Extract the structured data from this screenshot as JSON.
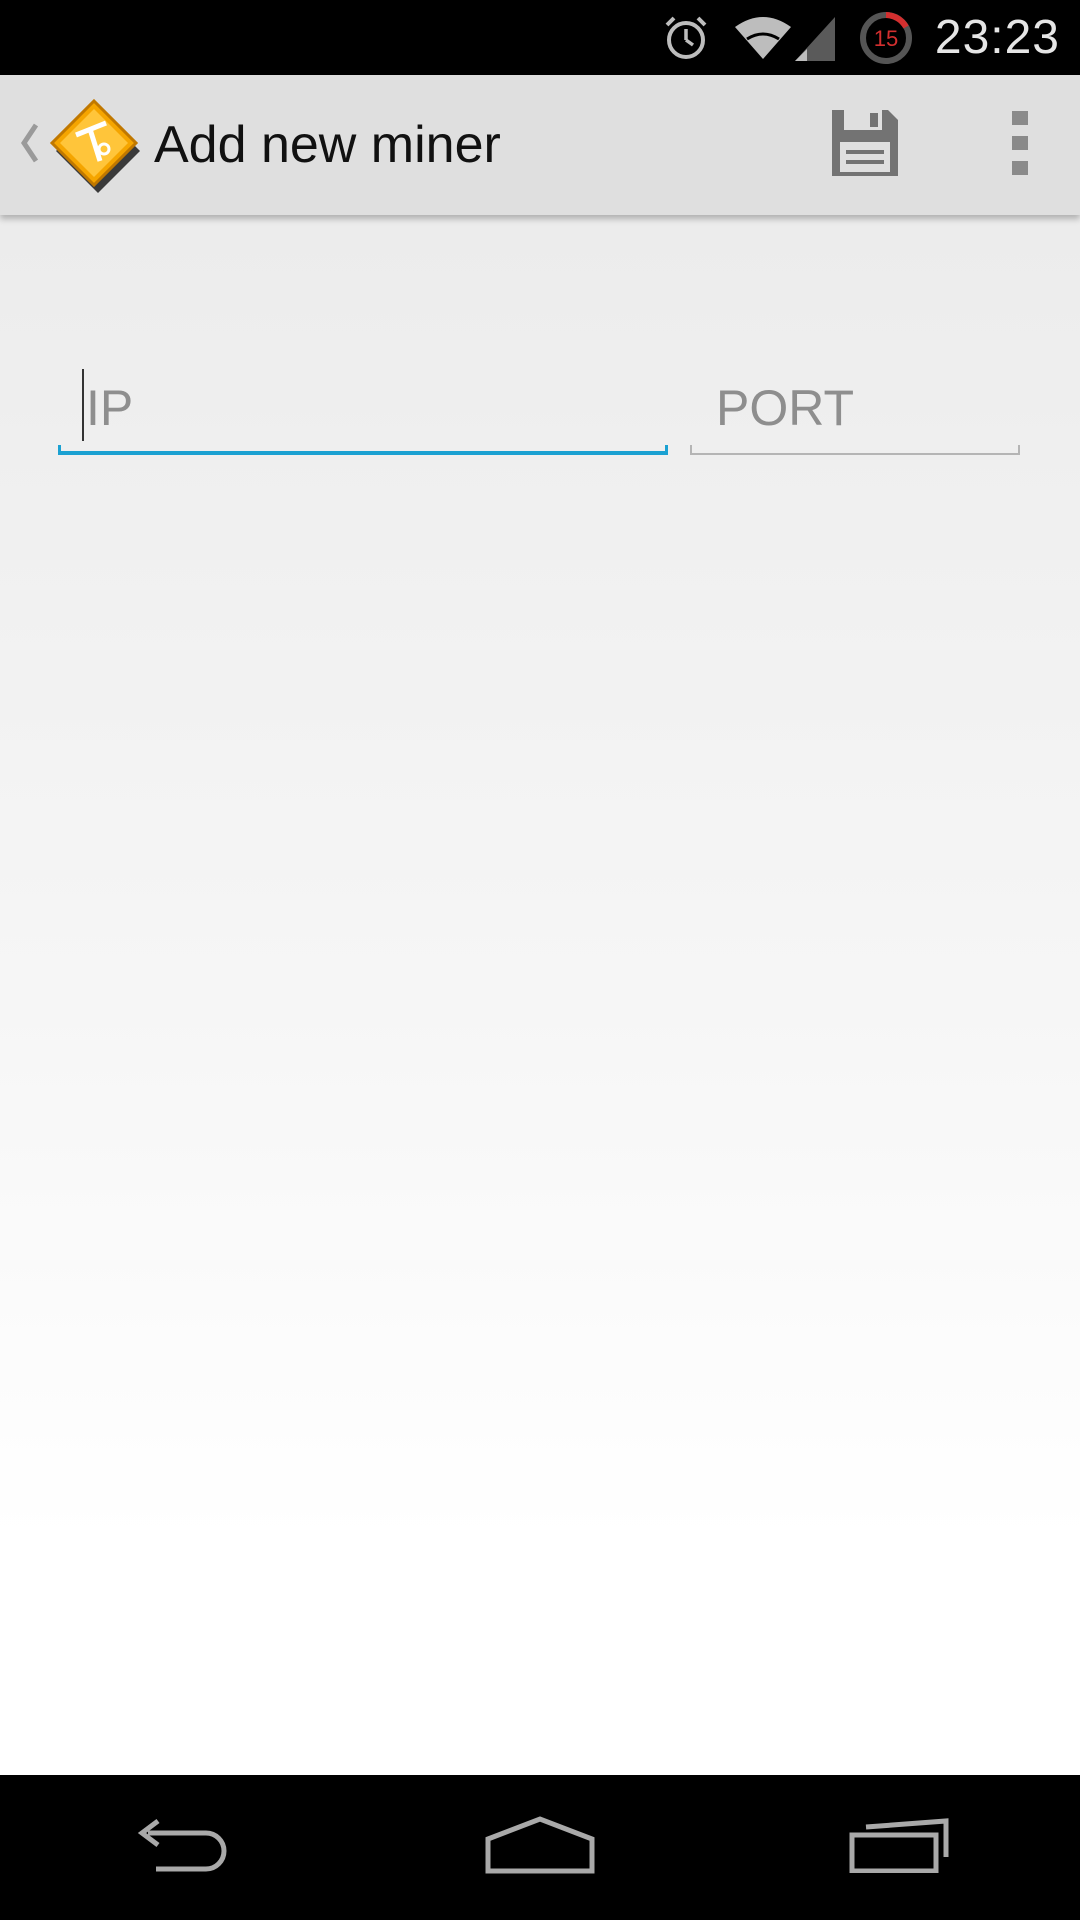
{
  "status_bar": {
    "time": "23:23",
    "timer_badge": "15",
    "icons": [
      "alarm-icon",
      "wifi-icon",
      "cell-signal-icon",
      "timer-icon"
    ]
  },
  "action_bar": {
    "title": "Add new miner",
    "icons": [
      "up-arrow-icon",
      "app-logo-icon",
      "save-icon",
      "overflow-menu-icon"
    ]
  },
  "form": {
    "ip_placeholder": "IP",
    "port_placeholder": "PORT"
  },
  "nav_bar": {
    "icons": [
      "back-icon",
      "home-icon",
      "recents-icon"
    ]
  },
  "colors": {
    "focus_accent": "#1ba1d2",
    "action_bar_bg": "#dfdfdf",
    "logo_orange": "#f5a500"
  }
}
